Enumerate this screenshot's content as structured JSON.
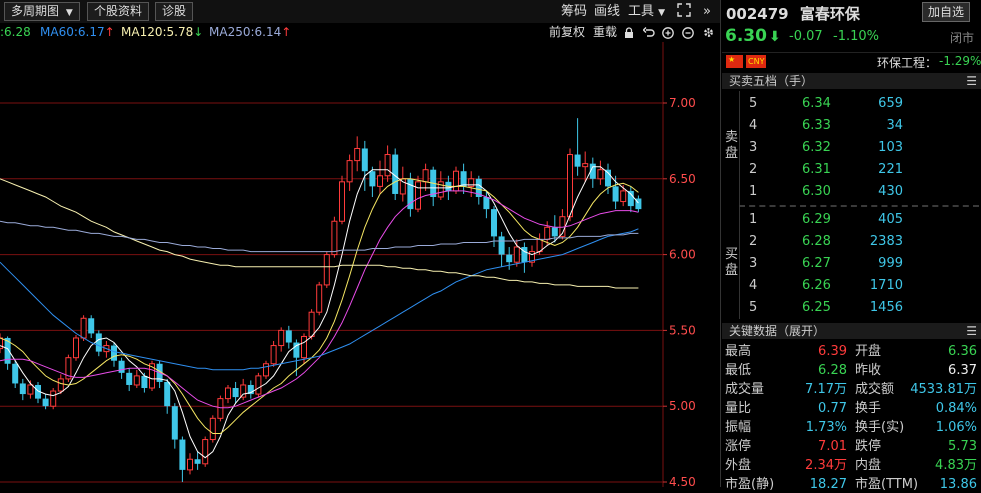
{
  "toolbar": {
    "period_label": "多周期图",
    "stock_info_label": "个股资料",
    "diagnose_label": "诊股",
    "chips_label": "筹码",
    "draw_label": "画线",
    "tools_label": "工具",
    "expand_glyph": "»"
  },
  "ma_bar": {
    "ma_prev": ":6.28",
    "ma60": "MA60:6.17",
    "ma60_arrow": "↑",
    "ma120": "MA120:5.78",
    "ma120_arrow": "↓",
    "ma250": "MA250:6.14",
    "ma250_arrow": "↑",
    "fq_label": "前复权",
    "redraw_label": "重载"
  },
  "quote": {
    "code": "002479",
    "name": "富春环保",
    "add_label": "加自选",
    "price": "6.30",
    "change": "-0.07",
    "change_pct": "-1.10%",
    "status": "闭市",
    "currency": "CNY",
    "sector": "环保工程：",
    "sector_pct": "-1.29%"
  },
  "orderbook": {
    "title": "买卖五档（手）",
    "sell_label": [
      "卖",
      "盘"
    ],
    "buy_label": [
      "买",
      "盘"
    ],
    "asks": [
      {
        "lvl": "5",
        "price": "6.34",
        "vol": "659"
      },
      {
        "lvl": "4",
        "price": "6.33",
        "vol": "34"
      },
      {
        "lvl": "3",
        "price": "6.32",
        "vol": "103"
      },
      {
        "lvl": "2",
        "price": "6.31",
        "vol": "221"
      },
      {
        "lvl": "1",
        "price": "6.30",
        "vol": "430"
      }
    ],
    "bids": [
      {
        "lvl": "1",
        "price": "6.29",
        "vol": "405"
      },
      {
        "lvl": "2",
        "price": "6.28",
        "vol": "2383"
      },
      {
        "lvl": "3",
        "price": "6.27",
        "vol": "999"
      },
      {
        "lvl": "4",
        "price": "6.26",
        "vol": "1710"
      },
      {
        "lvl": "5",
        "price": "6.25",
        "vol": "1456"
      }
    ]
  },
  "keydata": {
    "title": "关键数据（展开）",
    "rows": [
      {
        "l1": "最高",
        "v1": "6.39",
        "c1": "red",
        "l2": "开盘",
        "v2": "6.36",
        "c2": "green"
      },
      {
        "l1": "最低",
        "v1": "6.28",
        "c1": "green",
        "l2": "昨收",
        "v2": "6.37",
        "c2": "white"
      },
      {
        "l1": "成交量",
        "v1": "7.17万",
        "c1": "cyan",
        "l2": "成交额",
        "v2": "4533.81万",
        "c2": "cyan"
      },
      {
        "l1": "量比",
        "v1": "0.77",
        "c1": "cyan",
        "l2": "换手",
        "v2": "0.84%",
        "c2": "cyan"
      },
      {
        "l1": "振幅",
        "v1": "1.73%",
        "c1": "cyan",
        "l2": "换手(实)",
        "v2": "1.06%",
        "c2": "cyan"
      },
      {
        "l1": "涨停",
        "v1": "7.01",
        "c1": "red",
        "l2": "跌停",
        "v2": "5.73",
        "c2": "green"
      },
      {
        "l1": "外盘",
        "v1": "2.34万",
        "c1": "red",
        "l2": "内盘",
        "v2": "4.83万",
        "c2": "green"
      },
      {
        "l1": "市盈(静)",
        "v1": "18.27",
        "c1": "cyan",
        "l2": "市盈(TTM)",
        "v2": "13.86",
        "c2": "cyan"
      }
    ]
  },
  "colors": {
    "up": "#ff3b3b",
    "down": "#3fc7e8",
    "ma5": "#ffffff",
    "ma10": "#f5e663",
    "ma20": "#e84ce8",
    "ma30": "#39d353",
    "ma60": "#2f8ff0",
    "ma120": "#f7f0b0",
    "ma250": "#9aaad8",
    "grid": "#7a1010"
  },
  "chart_data": {
    "type": "candlestick",
    "y_ticks": [
      "7.00",
      "6.50",
      "6.00",
      "5.50",
      "5.00",
      "4.50"
    ],
    "ylim": [
      4.5,
      7.3
    ],
    "candles": [
      {
        "o": 5.38,
        "c": 5.45,
        "h": 5.48,
        "l": 5.35
      },
      {
        "o": 5.45,
        "c": 5.28,
        "h": 5.46,
        "l": 5.24
      },
      {
        "o": 5.28,
        "c": 5.15,
        "h": 5.3,
        "l": 5.12
      },
      {
        "o": 5.15,
        "c": 5.08,
        "h": 5.18,
        "l": 5.04
      },
      {
        "o": 5.08,
        "c": 5.14,
        "h": 5.17,
        "l": 5.05
      },
      {
        "o": 5.14,
        "c": 5.05,
        "h": 5.16,
        "l": 5.02
      },
      {
        "o": 5.05,
        "c": 5.0,
        "h": 5.08,
        "l": 4.98
      },
      {
        "o": 5.0,
        "c": 5.1,
        "h": 5.12,
        "l": 4.98
      },
      {
        "o": 5.1,
        "c": 5.18,
        "h": 5.21,
        "l": 5.08
      },
      {
        "o": 5.18,
        "c": 5.32,
        "h": 5.34,
        "l": 5.16
      },
      {
        "o": 5.32,
        "c": 5.45,
        "h": 5.47,
        "l": 5.3
      },
      {
        "o": 5.45,
        "c": 5.58,
        "h": 5.6,
        "l": 5.43
      },
      {
        "o": 5.58,
        "c": 5.48,
        "h": 5.6,
        "l": 5.45
      },
      {
        "o": 5.48,
        "c": 5.36,
        "h": 5.5,
        "l": 5.33
      },
      {
        "o": 5.36,
        "c": 5.4,
        "h": 5.43,
        "l": 5.32
      },
      {
        "o": 5.4,
        "c": 5.3,
        "h": 5.42,
        "l": 5.26
      },
      {
        "o": 5.3,
        "c": 5.22,
        "h": 5.32,
        "l": 5.18
      },
      {
        "o": 5.22,
        "c": 5.14,
        "h": 5.25,
        "l": 5.1
      },
      {
        "o": 5.14,
        "c": 5.2,
        "h": 5.24,
        "l": 5.12
      },
      {
        "o": 5.2,
        "c": 5.12,
        "h": 5.22,
        "l": 5.09
      },
      {
        "o": 5.12,
        "c": 5.28,
        "h": 5.3,
        "l": 5.1
      },
      {
        "o": 5.28,
        "c": 5.16,
        "h": 5.3,
        "l": 5.12
      },
      {
        "o": 5.16,
        "c": 5.0,
        "h": 5.18,
        "l": 4.95
      },
      {
        "o": 5.0,
        "c": 4.78,
        "h": 5.02,
        "l": 4.72
      },
      {
        "o": 4.78,
        "c": 4.58,
        "h": 4.8,
        "l": 4.5
      },
      {
        "o": 4.58,
        "c": 4.65,
        "h": 4.69,
        "l": 4.55
      },
      {
        "o": 4.65,
        "c": 4.62,
        "h": 4.7,
        "l": 4.58
      },
      {
        "o": 4.62,
        "c": 4.78,
        "h": 4.8,
        "l": 4.6
      },
      {
        "o": 4.78,
        "c": 4.92,
        "h": 4.94,
        "l": 4.76
      },
      {
        "o": 4.92,
        "c": 5.05,
        "h": 5.07,
        "l": 4.9
      },
      {
        "o": 5.05,
        "c": 5.12,
        "h": 5.14,
        "l": 5.02
      },
      {
        "o": 5.12,
        "c": 5.06,
        "h": 5.16,
        "l": 5.02
      },
      {
        "o": 5.06,
        "c": 5.14,
        "h": 5.18,
        "l": 5.04
      },
      {
        "o": 5.14,
        "c": 5.08,
        "h": 5.17,
        "l": 5.05
      },
      {
        "o": 5.08,
        "c": 5.2,
        "h": 5.22,
        "l": 5.06
      },
      {
        "o": 5.2,
        "c": 5.28,
        "h": 5.3,
        "l": 5.18
      },
      {
        "o": 5.28,
        "c": 5.4,
        "h": 5.43,
        "l": 5.26
      },
      {
        "o": 5.4,
        "c": 5.5,
        "h": 5.52,
        "l": 5.36
      },
      {
        "o": 5.5,
        "c": 5.42,
        "h": 5.53,
        "l": 5.38
      },
      {
        "o": 5.42,
        "c": 5.32,
        "h": 5.44,
        "l": 5.2
      },
      {
        "o": 5.32,
        "c": 5.46,
        "h": 5.48,
        "l": 5.28
      },
      {
        "o": 5.46,
        "c": 5.62,
        "h": 5.64,
        "l": 5.44
      },
      {
        "o": 5.62,
        "c": 5.8,
        "h": 5.82,
        "l": 5.6
      },
      {
        "o": 5.8,
        "c": 6.0,
        "h": 6.02,
        "l": 5.78
      },
      {
        "o": 6.0,
        "c": 6.22,
        "h": 6.25,
        "l": 5.98
      },
      {
        "o": 6.22,
        "c": 6.48,
        "h": 6.52,
        "l": 6.2
      },
      {
        "o": 6.48,
        "c": 6.62,
        "h": 6.66,
        "l": 6.42
      },
      {
        "o": 6.62,
        "c": 6.7,
        "h": 6.78,
        "l": 6.55
      },
      {
        "o": 6.7,
        "c": 6.55,
        "h": 6.75,
        "l": 6.42
      },
      {
        "o": 6.55,
        "c": 6.45,
        "h": 6.58,
        "l": 6.38
      },
      {
        "o": 6.45,
        "c": 6.52,
        "h": 6.62,
        "l": 6.4
      },
      {
        "o": 6.52,
        "c": 6.66,
        "h": 6.72,
        "l": 6.48
      },
      {
        "o": 6.66,
        "c": 6.4,
        "h": 6.7,
        "l": 6.36
      },
      {
        "o": 6.4,
        "c": 6.5,
        "h": 6.58,
        "l": 6.35
      },
      {
        "o": 6.5,
        "c": 6.3,
        "h": 6.54,
        "l": 6.25
      },
      {
        "o": 6.3,
        "c": 6.48,
        "h": 6.52,
        "l": 6.28
      },
      {
        "o": 6.48,
        "c": 6.56,
        "h": 6.6,
        "l": 6.42
      },
      {
        "o": 6.56,
        "c": 6.38,
        "h": 6.58,
        "l": 6.32
      },
      {
        "o": 6.38,
        "c": 6.48,
        "h": 6.55,
        "l": 6.36
      },
      {
        "o": 6.48,
        "c": 6.42,
        "h": 6.52,
        "l": 6.36
      },
      {
        "o": 6.42,
        "c": 6.55,
        "h": 6.58,
        "l": 6.4
      },
      {
        "o": 6.55,
        "c": 6.45,
        "h": 6.6,
        "l": 6.4
      },
      {
        "o": 6.45,
        "c": 6.5,
        "h": 6.55,
        "l": 6.38
      },
      {
        "o": 6.5,
        "c": 6.38,
        "h": 6.52,
        "l": 6.33
      },
      {
        "o": 6.38,
        "c": 6.3,
        "h": 6.42,
        "l": 6.24
      },
      {
        "o": 6.3,
        "c": 6.12,
        "h": 6.32,
        "l": 6.05
      },
      {
        "o": 6.12,
        "c": 6.0,
        "h": 6.15,
        "l": 5.92
      },
      {
        "o": 6.0,
        "c": 5.95,
        "h": 6.05,
        "l": 5.9
      },
      {
        "o": 5.95,
        "c": 6.05,
        "h": 6.1,
        "l": 5.92
      },
      {
        "o": 6.05,
        "c": 5.95,
        "h": 6.08,
        "l": 5.88
      },
      {
        "o": 5.95,
        "c": 6.02,
        "h": 6.06,
        "l": 5.92
      },
      {
        "o": 6.02,
        "c": 6.1,
        "h": 6.14,
        "l": 6.0
      },
      {
        "o": 6.1,
        "c": 6.18,
        "h": 6.22,
        "l": 6.06
      },
      {
        "o": 6.18,
        "c": 6.12,
        "h": 6.26,
        "l": 6.08
      },
      {
        "o": 6.12,
        "c": 6.25,
        "h": 6.3,
        "l": 6.1
      },
      {
        "o": 6.25,
        "c": 6.66,
        "h": 6.7,
        "l": 6.22
      },
      {
        "o": 6.66,
        "c": 6.58,
        "h": 6.9,
        "l": 6.52
      },
      {
        "o": 6.58,
        "c": 6.6,
        "h": 6.68,
        "l": 6.48
      },
      {
        "o": 6.6,
        "c": 6.5,
        "h": 6.64,
        "l": 6.44
      },
      {
        "o": 6.5,
        "c": 6.56,
        "h": 6.62,
        "l": 6.46
      },
      {
        "o": 6.56,
        "c": 6.45,
        "h": 6.6,
        "l": 6.4
      },
      {
        "o": 6.45,
        "c": 6.35,
        "h": 6.52,
        "l": 6.3
      },
      {
        "o": 6.35,
        "c": 6.42,
        "h": 6.46,
        "l": 6.32
      },
      {
        "o": 6.42,
        "c": 6.32,
        "h": 6.45,
        "l": 6.28
      },
      {
        "o": 6.37,
        "c": 6.3,
        "h": 6.39,
        "l": 6.28
      }
    ],
    "ma_lines": {
      "ma5": [
        5.4,
        5.38,
        5.3,
        5.22,
        5.15,
        5.1,
        5.08,
        5.07,
        5.09,
        5.13,
        5.22,
        5.32,
        5.4,
        5.44,
        5.45,
        5.42,
        5.36,
        5.3,
        5.26,
        5.2,
        5.18,
        5.18,
        5.17,
        5.1,
        4.96,
        4.8,
        4.7,
        4.66,
        4.7,
        4.8,
        4.94,
        5.02,
        5.08,
        5.09,
        5.12,
        5.15,
        5.2,
        5.28,
        5.36,
        5.4,
        5.42,
        5.46,
        5.52,
        5.62,
        5.8,
        6.0,
        6.22,
        6.4,
        6.52,
        6.56,
        6.56,
        6.56,
        6.52,
        6.48,
        6.46,
        6.44,
        6.44,
        6.44,
        6.44,
        6.44,
        6.45,
        6.46,
        6.46,
        6.46,
        6.42,
        6.34,
        6.24,
        6.14,
        6.06,
        6.02,
        6.0,
        6.02,
        6.06,
        6.09,
        6.14,
        6.26,
        6.38,
        6.48,
        6.58,
        6.58,
        6.54,
        6.48,
        6.44,
        6.4,
        6.34
      ],
      "ma10": [
        5.45,
        5.43,
        5.4,
        5.36,
        5.3,
        5.25,
        5.2,
        5.17,
        5.15,
        5.14,
        5.15,
        5.18,
        5.22,
        5.26,
        5.3,
        5.33,
        5.34,
        5.33,
        5.31,
        5.28,
        5.26,
        5.23,
        5.2,
        5.15,
        5.08,
        5.0,
        4.92,
        4.86,
        4.82,
        4.82,
        4.86,
        4.91,
        4.96,
        5.0,
        5.04,
        5.08,
        5.12,
        5.15,
        5.2,
        5.24,
        5.28,
        5.32,
        5.37,
        5.45,
        5.56,
        5.7,
        5.86,
        6.03,
        6.18,
        6.3,
        6.4,
        6.45,
        6.48,
        6.5,
        6.5,
        6.49,
        6.48,
        6.47,
        6.46,
        6.45,
        6.45,
        6.45,
        6.44,
        6.43,
        6.42,
        6.38,
        6.33,
        6.28,
        6.22,
        6.16,
        6.12,
        6.1,
        6.08,
        6.06,
        6.08,
        6.12,
        6.18,
        6.26,
        6.34,
        6.4,
        6.44,
        6.46,
        6.47,
        6.45,
        6.41
      ],
      "ma20": [
        5.3,
        5.31,
        5.31,
        5.31,
        5.3,
        5.28,
        5.26,
        5.24,
        5.22,
        5.2,
        5.19,
        5.19,
        5.2,
        5.21,
        5.22,
        5.23,
        5.24,
        5.25,
        5.25,
        5.25,
        5.24,
        5.22,
        5.2,
        5.16,
        5.12,
        5.08,
        5.04,
        5.02,
        5.0,
        4.99,
        4.99,
        5.0,
        5.02,
        5.04,
        5.06,
        5.08,
        5.1,
        5.12,
        5.15,
        5.18,
        5.22,
        5.27,
        5.32,
        5.38,
        5.46,
        5.55,
        5.66,
        5.78,
        5.9,
        6.0,
        6.1,
        6.18,
        6.25,
        6.3,
        6.34,
        6.37,
        6.39,
        6.4,
        6.41,
        6.42,
        6.42,
        6.42,
        6.41,
        6.4,
        6.38,
        6.36,
        6.33,
        6.3,
        6.27,
        6.24,
        6.22,
        6.2,
        6.19,
        6.18,
        6.18,
        6.19,
        6.21,
        6.23,
        6.25,
        6.27,
        6.28,
        6.29,
        6.29,
        6.29,
        6.28
      ],
      "ma60": [
        5.95,
        5.9,
        5.85,
        5.8,
        5.75,
        5.7,
        5.65,
        5.6,
        5.56,
        5.52,
        5.48,
        5.45,
        5.42,
        5.4,
        5.38,
        5.36,
        5.35,
        5.34,
        5.33,
        5.32,
        5.31,
        5.3,
        5.29,
        5.28,
        5.27,
        5.26,
        5.25,
        5.25,
        5.24,
        5.24,
        5.24,
        5.24,
        5.24,
        5.25,
        5.25,
        5.26,
        5.27,
        5.28,
        5.29,
        5.3,
        5.31,
        5.32,
        5.33,
        5.35,
        5.37,
        5.39,
        5.41,
        5.44,
        5.47,
        5.5,
        5.53,
        5.56,
        5.59,
        5.62,
        5.65,
        5.68,
        5.71,
        5.74,
        5.76,
        5.79,
        5.82,
        5.84,
        5.86,
        5.88,
        5.9,
        5.91,
        5.92,
        5.93,
        5.94,
        5.95,
        5.96,
        5.97,
        5.98,
        5.99,
        6.0,
        6.02,
        6.04,
        6.06,
        6.08,
        6.1,
        6.12,
        6.13,
        6.14,
        6.15,
        6.17
      ],
      "ma120": [
        6.5,
        6.48,
        6.46,
        6.44,
        6.42,
        6.4,
        6.38,
        6.35,
        6.32,
        6.3,
        6.28,
        6.25,
        6.22,
        6.2,
        6.18,
        6.15,
        6.13,
        6.11,
        6.09,
        6.07,
        6.05,
        6.03,
        6.02,
        6.0,
        5.99,
        5.97,
        5.96,
        5.95,
        5.94,
        5.93,
        5.93,
        5.92,
        5.92,
        5.92,
        5.92,
        5.92,
        5.92,
        5.92,
        5.92,
        5.92,
        5.92,
        5.92,
        5.92,
        5.92,
        5.92,
        5.93,
        5.93,
        5.93,
        5.93,
        5.93,
        5.93,
        5.92,
        5.92,
        5.91,
        5.91,
        5.9,
        5.9,
        5.89,
        5.89,
        5.88,
        5.88,
        5.87,
        5.86,
        5.86,
        5.85,
        5.85,
        5.84,
        5.83,
        5.83,
        5.82,
        5.82,
        5.81,
        5.81,
        5.8,
        5.8,
        5.8,
        5.79,
        5.79,
        5.79,
        5.79,
        5.79,
        5.78,
        5.78,
        5.78,
        5.78
      ],
      "ma250": [
        6.22,
        6.21,
        6.21,
        6.2,
        6.19,
        6.19,
        6.18,
        6.18,
        6.17,
        6.16,
        6.16,
        6.15,
        6.14,
        6.14,
        6.13,
        6.12,
        6.12,
        6.11,
        6.1,
        6.1,
        6.09,
        6.08,
        6.08,
        6.07,
        6.06,
        6.06,
        6.05,
        6.05,
        6.04,
        6.04,
        6.03,
        6.03,
        6.03,
        6.02,
        6.02,
        6.02,
        6.02,
        6.02,
        6.02,
        6.02,
        6.02,
        6.02,
        6.02,
        6.02,
        6.02,
        6.03,
        6.03,
        6.03,
        6.03,
        6.04,
        6.04,
        6.04,
        6.05,
        6.05,
        6.05,
        6.06,
        6.06,
        6.06,
        6.07,
        6.07,
        6.07,
        6.08,
        6.08,
        6.08,
        6.08,
        6.09,
        6.09,
        6.09,
        6.09,
        6.1,
        6.1,
        6.1,
        6.1,
        6.11,
        6.11,
        6.11,
        6.12,
        6.12,
        6.12,
        6.12,
        6.13,
        6.13,
        6.13,
        6.14,
        6.14
      ]
    }
  }
}
